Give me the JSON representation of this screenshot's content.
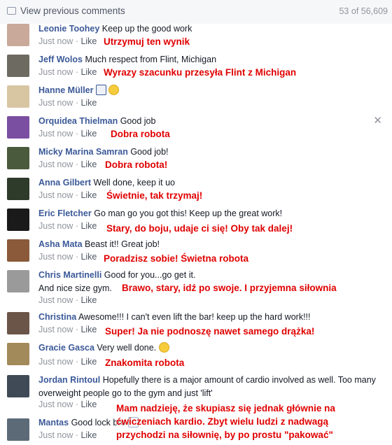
{
  "header": {
    "view_previous": "View previous comments",
    "count": "53 of 56,609"
  },
  "close_icon": "close-icon",
  "comments": [
    {
      "name": "Leonie Toohey",
      "text": "Keep up the good work",
      "time": "Just now",
      "like": "Like",
      "translation": "Utrzymuj ten wynik",
      "avatar_color": "#c9a99a"
    },
    {
      "name": "Jeff Wolos",
      "text": "Much respect from Flint, Michigan",
      "time": "Just now",
      "like": "Like",
      "translation": "Wyrazy szacunku przesyła Flint z Michigan",
      "avatar_color": "#6d6a62"
    },
    {
      "name": "Hanne Müller",
      "text": "",
      "time": "Just now",
      "like": "Like",
      "translation": "",
      "avatar_color": "#d8c6a3"
    },
    {
      "name": "Orquidea Thielman",
      "text": "Good job",
      "time": "Just now",
      "like": "Like",
      "translation": "Dobra robota",
      "avatar_color": "#7a4ea0"
    },
    {
      "name": "Micky Marina Samran",
      "text": "Good job!",
      "time": "Just now",
      "like": "Like",
      "translation": "Dobra robota!",
      "avatar_color": "#4a5a3c"
    },
    {
      "name": "Anna Gilbert",
      "text": "Well done, keep it uo",
      "time": "Just now",
      "like": "Like",
      "translation": "Świetnie, tak trzymaj!",
      "avatar_color": "#2e3a2a"
    },
    {
      "name": "Eric Fletcher",
      "text": "Go man go you got this! Keep up the great work!",
      "time": "Just now",
      "like": "Like",
      "translation": "Stary, do boju, udaje ci się! Oby tak dalej!",
      "avatar_color": "#1a1a1a"
    },
    {
      "name": "Asha Mata",
      "text": "Beast it!! Great job!",
      "time": "Just now",
      "like": "Like",
      "translation": "Poradzisz sobie! Świetna robota",
      "avatar_color": "#8a5a3a"
    },
    {
      "name": "Chris Martinelli",
      "text": "Good for you...go get it.",
      "text2": "And nice size gym.",
      "time": "Just now",
      "like": "Like",
      "translation": "Brawo, stary, idź po swoje. I przyjemna siłownia",
      "avatar_color": "#9a9a9a"
    },
    {
      "name": "Christina",
      "text": "Awesome!!! I can't even lift the bar! keep up the hard work!!!",
      "time": "Just now",
      "like": "Like",
      "translation": "Super! Ja nie podnoszę nawet samego drążka!",
      "avatar_color": "#6a5548"
    },
    {
      "name": "Gracie Gasca",
      "text": "Very well done.",
      "time": "Just now",
      "like": "Like",
      "translation": "Znakomita robota",
      "avatar_color": "#a38a5a"
    },
    {
      "name": "Jordan Rintoul",
      "text": "Hopefully there is a major amount of cardio involved as well. Too many overweight people go to the gym and just 'lift'",
      "time": "Just now",
      "like": "Like",
      "translation_lines": [
        "Mam nadzieję, że skupiasz się jednak głównie na",
        "ćwiczeniach kardio. Zbyt wielu ludzi z nadwagą",
        "przychodzi na siłownię, by po prostu \"pakować\""
      ],
      "avatar_color": "#3f4a56"
    },
    {
      "name": "Mantas",
      "text": "Good lock bro",
      "time": "Just now",
      "like": "Like",
      "avatar_color": "#5c6a78"
    }
  ]
}
